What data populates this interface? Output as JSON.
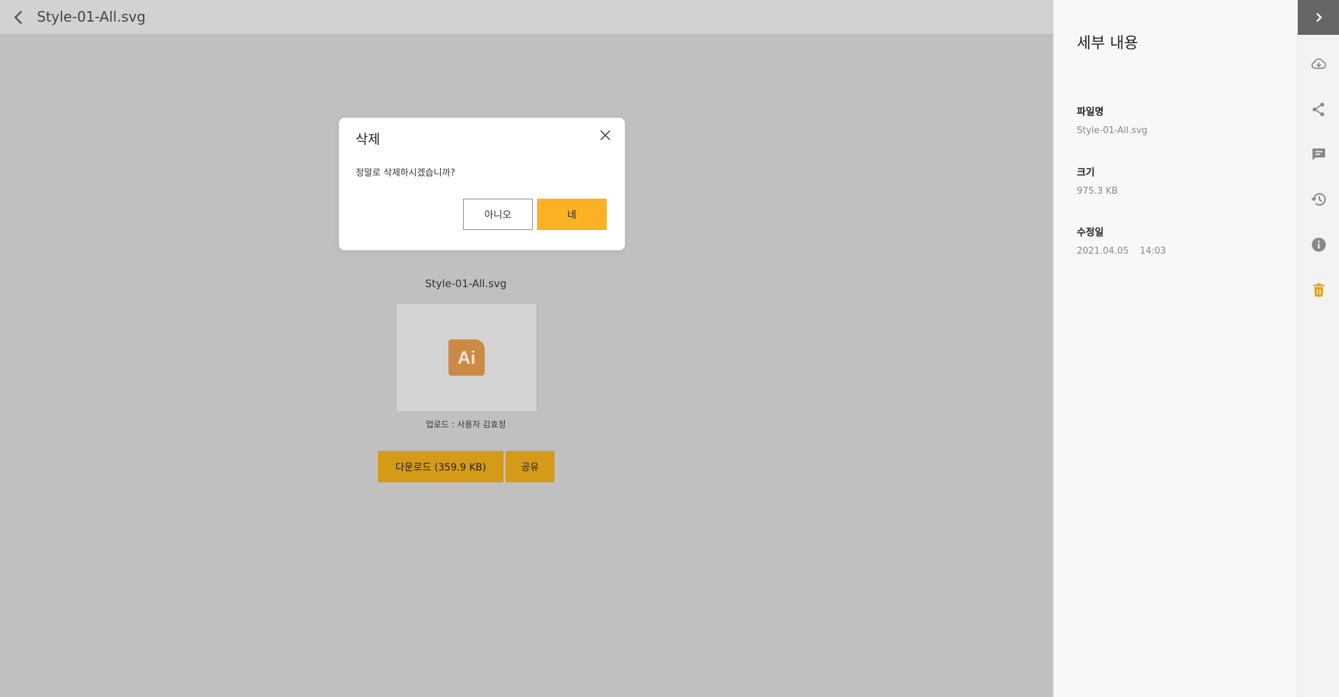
{
  "header": {
    "title": "Style-01-All.svg"
  },
  "preview": {
    "filename": "Style-01-All.svg",
    "badge": "Ai",
    "uploader": "업로드 : 사용자 김효정",
    "download_label": "다운로드 (359.9 KB)",
    "share_label": "공유"
  },
  "dialog": {
    "title": "삭제",
    "message": "정말로 삭제하시겠습니까?",
    "no_label": "아니오",
    "yes_label": "네"
  },
  "details": {
    "title": "세부 내용",
    "filename_label": "파일명",
    "filename_value": "Style-01-All.svg",
    "size_label": "크기",
    "size_value": "975.3 KB",
    "modified_label": "수정일",
    "modified_date": "2021.04.05",
    "modified_time": "14:03"
  },
  "rail": {
    "icons": [
      "chevron-right-icon",
      "cloud-download-icon",
      "share-icon",
      "comment-icon",
      "history-icon",
      "info-icon",
      "trash-icon"
    ]
  },
  "colors": {
    "accent": "#fbb124",
    "accent_dimmed": "#d59a18",
    "trash": "#e5a01b",
    "overlay_bg": "#c0c0c0"
  }
}
